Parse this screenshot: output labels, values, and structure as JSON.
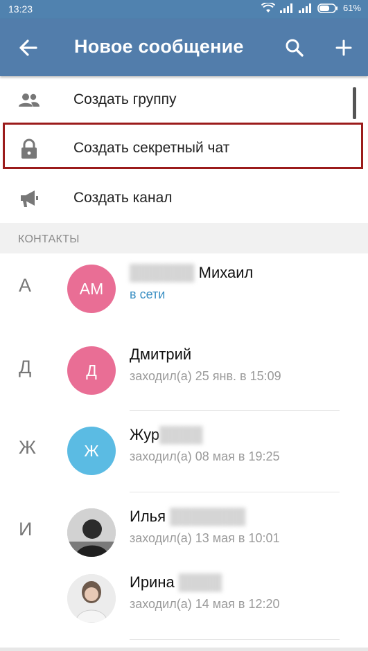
{
  "status_bar": {
    "time": "13:23",
    "battery": "61%"
  },
  "app_bar": {
    "title": "Новое сообщение"
  },
  "menu": [
    {
      "label": "Создать группу",
      "icon": "group-icon"
    },
    {
      "label": "Создать секретный чат",
      "icon": "lock-icon"
    },
    {
      "label": "Создать канал",
      "icon": "megaphone-icon"
    }
  ],
  "section_header": "КОНТАКТЫ",
  "contacts": [
    {
      "letter": "А",
      "initials": "АМ",
      "name": "Михаил",
      "status": "в сети",
      "avatar_color": "#e96e95"
    },
    {
      "letter": "Д",
      "initials": "Д",
      "name": "Дмитрий",
      "status": "заходил(а) 25 янв. в 15:09",
      "avatar_color": "#e96e95"
    },
    {
      "letter": "Ж",
      "initials": "Ж",
      "name": "Жур",
      "status": "заходил(а) 08 мая в 19:25",
      "avatar_color": "#5bbbe3"
    },
    {
      "letter": "И",
      "initials": "",
      "name": "Илья",
      "status": "заходил(а) 13 мая в 10:01",
      "avatar_color": "#9a9a9a"
    },
    {
      "letter": "",
      "initials": "",
      "name": "Ирина",
      "status": "заходил(а) 14 мая в 12:20",
      "avatar_color": "#cfcfcf"
    }
  ],
  "colors": {
    "accent": "#527dab",
    "online": "#3a8fc3",
    "highlight": "#9b1b1b"
  }
}
